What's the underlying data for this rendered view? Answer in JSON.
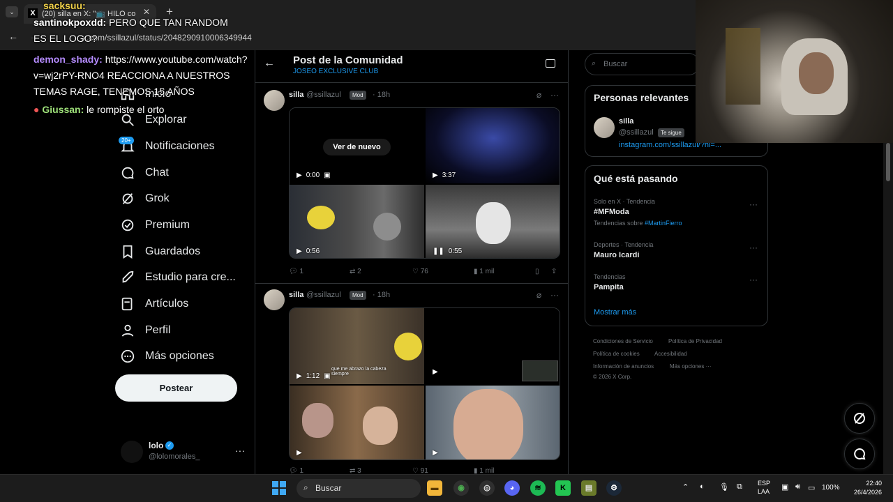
{
  "browser": {
    "tab_title": "(20) silla en X: \"📺 HILO co",
    "tab_close": "✕",
    "new_tab": "+",
    "tab_list": "⌄",
    "url": "x.com/ssillazul/status/2048290910006349944"
  },
  "nav": {
    "items": [
      {
        "label": "Inicio",
        "icon": "home-icon"
      },
      {
        "label": "Explorar",
        "icon": "search-icon"
      },
      {
        "label": "Notificaciones",
        "icon": "bell-icon"
      },
      {
        "label": "Chat",
        "icon": "chat-icon"
      },
      {
        "label": "Grok",
        "icon": "grok-icon"
      },
      {
        "label": "Premium",
        "icon": "premium-icon"
      },
      {
        "label": "Guardados",
        "icon": "bookmark-icon"
      },
      {
        "label": "Estudio para cre...",
        "icon": "rocket-icon"
      },
      {
        "label": "Artículos",
        "icon": "article-icon"
      },
      {
        "label": "Perfil",
        "icon": "user-icon"
      },
      {
        "label": "Más opciones",
        "icon": "more-circle-icon"
      }
    ],
    "notif_badge": "20+",
    "post_button": "Postear"
  },
  "account": {
    "name": "lolo",
    "handle": "@lolomorales_",
    "more": "···"
  },
  "header": {
    "title": "Post de la Comunidad",
    "subtitle": "JOSEO EXCLUSIVE CLUB"
  },
  "posts": [
    {
      "name": "silla",
      "handle": "@ssillazul",
      "badge": "Mod",
      "time": "· 18h",
      "more": "···",
      "media": [
        {
          "overlay": "Ver de nuevo",
          "time": "0:00",
          "ctrl": "▶"
        },
        {
          "time": "3:37",
          "ctrl": "▶"
        },
        {
          "time": "0:56",
          "ctrl": "▶"
        },
        {
          "time": "0:55",
          "ctrl": "❚❚"
        }
      ],
      "replies": "1",
      "reposts": "2",
      "likes": "76",
      "views": "1 mil"
    },
    {
      "name": "silla",
      "handle": "@ssillazul",
      "badge": "Mod",
      "time": "· 18h",
      "more": "···",
      "media": [
        {
          "time": "1:12",
          "ctrl": "▶",
          "caption": "que me abrazo la cabeza siempre"
        },
        {
          "time": "",
          "ctrl": "▶"
        },
        {
          "time": "",
          "ctrl": "▶"
        },
        {
          "time": "",
          "ctrl": "▶"
        }
      ],
      "replies": "1",
      "reposts": "3",
      "likes": "91",
      "views": "1 mil"
    }
  ],
  "right": {
    "search_placeholder": "Buscar",
    "relevant_title": "Personas relevantes",
    "person_name": "silla",
    "person_handle": "@ssillazul",
    "person_badge": "Te sigue",
    "person_link": "instagram.com/ssillazul/?hl=...",
    "happening_title": "Qué está pasando",
    "trends": [
      {
        "context": "Solo en X · Tendencia",
        "name": "#MFModa",
        "extra_prefix": "Tendencias sobre ",
        "extra_link": "#MartinFierro"
      },
      {
        "context": "Deportes · Tendencia",
        "name": "Mauro Icardi"
      },
      {
        "context": "Tendencias",
        "name": "Pampita"
      }
    ],
    "trend_more": "···",
    "show_more": "Mostrar más",
    "footer": [
      "Condiciones de Servicio",
      "Política de Privacidad",
      "Política de cookies",
      "Accesibilidad",
      "Información de anuncios",
      "Más opciones ···",
      "© 2026 X Corp."
    ]
  },
  "chat_overlay": [
    {
      "user": "sacksuu:",
      "text": "",
      "color": "#f2d34a"
    },
    {
      "user": "santinokpoxdd:",
      "text": " PERO QUE TAN RANDOM",
      "color": "#ffffff"
    },
    {
      "user": "",
      "text": "ES EL LOGO?",
      "color": "#ffffff"
    },
    {
      "user": "demon_shady:",
      "text": " https://www.youtube.com/watch?",
      "color": "#b58cff"
    },
    {
      "user": "",
      "text": "v=wj2rPY-RNO4 REACCIONA A NUESTROS",
      "color": "#ffffff"
    },
    {
      "user": "",
      "text": "TEMAS RAGE, TENEMOS 15 AÑOS",
      "color": "#ffffff"
    },
    {
      "user": "Giussan:",
      "text": " le rompiste el orto",
      "color": "#9fe27a"
    }
  ],
  "taskbar": {
    "search": "Buscar",
    "lang_top": "ESP",
    "lang_bottom": "LAA",
    "battery": "100%",
    "time": "22:40",
    "date": "26/4/2026"
  }
}
